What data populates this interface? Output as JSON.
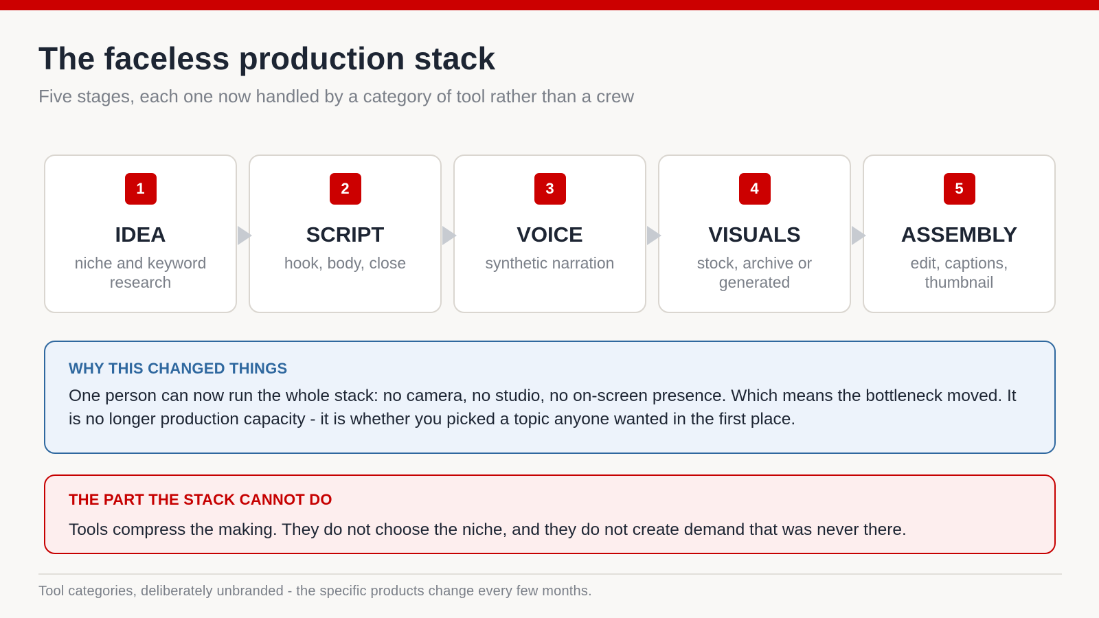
{
  "header": {
    "title": "The faceless production stack",
    "subtitle": "Five stages, each one now handled by a category of tool rather than a crew"
  },
  "stages": [
    {
      "number": "1",
      "name": "IDEA",
      "description": "niche and keyword research"
    },
    {
      "number": "2",
      "name": "SCRIPT",
      "description": "hook, body, close"
    },
    {
      "number": "3",
      "name": "VOICE",
      "description": "synthetic narration"
    },
    {
      "number": "4",
      "name": "VISUALS",
      "description": "stock, archive or generated"
    },
    {
      "number": "5",
      "name": "ASSEMBLY",
      "description": "edit, captions, thumbnail"
    }
  ],
  "callouts": {
    "why": {
      "heading": "WHY THIS CHANGED THINGS",
      "body": "One person can now run the whole stack: no camera, no studio, no on-screen presence. Which means the bottleneck moved. It is no longer production capacity - it is whether you picked a topic anyone wanted in the first place."
    },
    "cannot": {
      "heading": "THE PART THE STACK CANNOT DO",
      "body": "Tools compress the making. They do not choose the niche, and they do not create demand that was never there."
    }
  },
  "footnote": "Tool categories, deliberately unbranded - the specific products change every few months.",
  "colors": {
    "accent": "#cc0000",
    "info": "#2f689f",
    "text": "#1d2533",
    "muted": "#7a7f88"
  }
}
